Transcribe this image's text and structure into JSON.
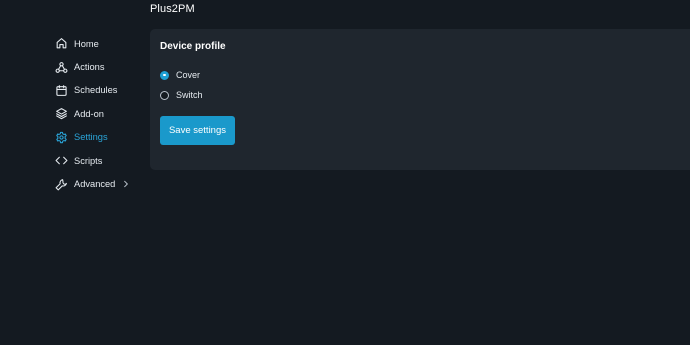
{
  "header": {
    "device_name": "Plus2PM"
  },
  "sidebar": {
    "items": [
      {
        "label": "Home",
        "icon": "home-icon",
        "active": false
      },
      {
        "label": "Actions",
        "icon": "actions-icon",
        "active": false
      },
      {
        "label": "Schedules",
        "icon": "calendar-icon",
        "active": false
      },
      {
        "label": "Add-on",
        "icon": "layers-icon",
        "active": false
      },
      {
        "label": "Settings",
        "icon": "gear-icon",
        "active": true
      },
      {
        "label": "Scripts",
        "icon": "code-icon",
        "active": false
      },
      {
        "label": "Advanced",
        "icon": "wrench-icon",
        "active": false,
        "has_submenu": true
      }
    ]
  },
  "profile": {
    "title": "Device profile",
    "options": [
      {
        "label": "Cover",
        "selected": true
      },
      {
        "label": "Switch",
        "selected": false
      }
    ],
    "save_label": "Save settings"
  },
  "colors": {
    "background": "#141a21",
    "panel": "#1f262e",
    "accent": "#1a99cb",
    "active_nav": "#2aa5d9"
  }
}
